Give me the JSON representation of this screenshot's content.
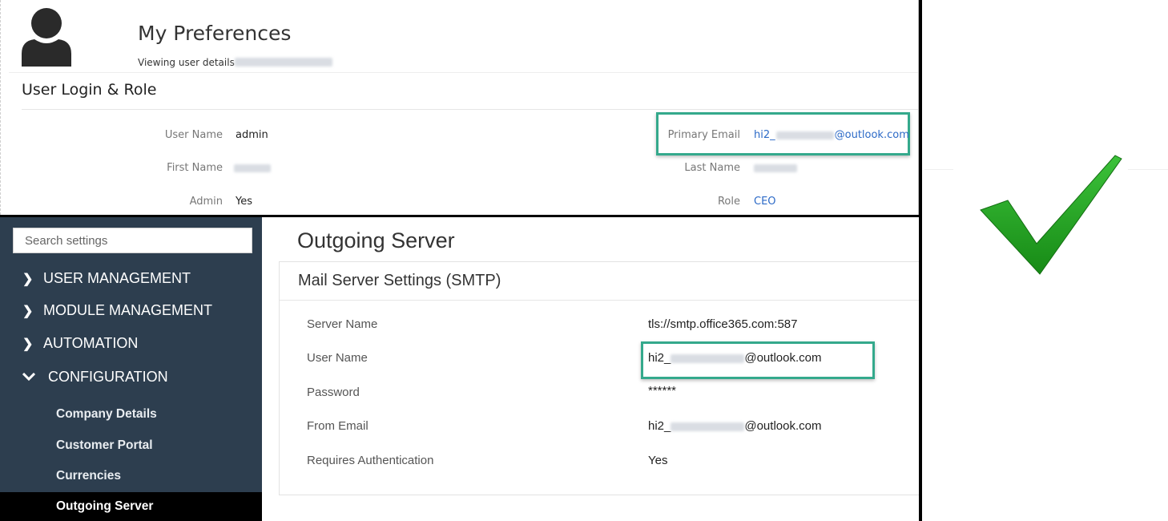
{
  "preferences": {
    "title": "My Preferences",
    "viewing_label": "Viewing user details",
    "section_title": "User Login & Role",
    "fields": {
      "user_name_label": "User Name",
      "user_name_value": "admin",
      "first_name_label": "First Name",
      "admin_label": "Admin",
      "admin_value": "Yes",
      "primary_email_label": "Primary Email",
      "primary_email_prefix": "hi2_",
      "primary_email_suffix": "@outlook.com",
      "last_name_label": "Last Name",
      "role_label": "Role",
      "role_value": "CEO"
    }
  },
  "sidebar": {
    "search_placeholder": "Search settings",
    "nav": [
      {
        "label": "USER MANAGEMENT",
        "expanded": false
      },
      {
        "label": "MODULE MANAGEMENT",
        "expanded": false
      },
      {
        "label": "AUTOMATION",
        "expanded": false
      },
      {
        "label": "CONFIGURATION",
        "expanded": true
      }
    ],
    "sub_items": [
      {
        "label": "Company Details"
      },
      {
        "label": "Customer Portal"
      },
      {
        "label": "Currencies"
      },
      {
        "label": "Outgoing Server",
        "active": true
      }
    ]
  },
  "outgoing": {
    "page_title": "Outgoing Server",
    "card_title": "Mail Server Settings (SMTP)",
    "rows": [
      {
        "label": "Server Name",
        "value": "tls://smtp.office365.com:587"
      },
      {
        "label": "User Name",
        "prefix": "hi2_",
        "suffix": "@outlook.com"
      },
      {
        "label": "Password",
        "value": "******"
      },
      {
        "label": "From Email",
        "prefix": "hi2_",
        "suffix": "@outlook.com"
      },
      {
        "label": "Requires Authentication",
        "value": "Yes"
      }
    ]
  },
  "colors": {
    "sidebar_bg": "#2d3e4f",
    "highlight": "#34a98c",
    "link": "#2c6ac7",
    "check_green": "#1f9a1c"
  },
  "icons": {
    "avatar": "user-avatar-icon",
    "chevron_right": "chevron-right-icon",
    "chevron_down": "chevron-down-icon",
    "checkmark": "checkmark-icon"
  }
}
